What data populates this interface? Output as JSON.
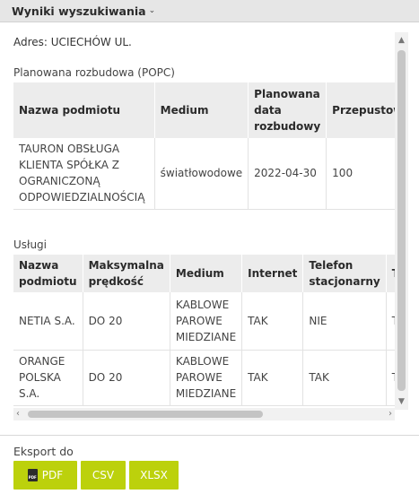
{
  "header": {
    "title": "Wyniki wyszukiwania",
    "chevron_icon": "chevron-down-icon"
  },
  "address": "Adres: UCIECHÓW UL.",
  "planned": {
    "title": "Planowana rozbudowa (POPC)",
    "headers": [
      "Nazwa podmiotu",
      "Medium",
      "Planowana data rozbudowy",
      "Przepustowość"
    ],
    "rows": [
      [
        "TAURON OBSŁUGA KLIENTA SPÓŁKA Z OGRANICZONĄ ODPOWIEDZIALNOŚCIĄ",
        "światłowodowe",
        "2022-04-30",
        "100"
      ]
    ]
  },
  "services": {
    "title": "Usługi",
    "headers": [
      "Nazwa podmiotu",
      "Maksymalna prędkość",
      "Medium",
      "Internet",
      "Telefon stacjonarny",
      "Telewizja"
    ],
    "rows": [
      [
        "NETIA S.A.",
        "DO 20",
        "KABLOWE PAROWE MIEDZIANE",
        "TAK",
        "NIE",
        "TAK"
      ],
      [
        "ORANGE POLSKA S.A.",
        "DO 20",
        "KABLOWE PAROWE MIEDZIANE",
        "TAK",
        "TAK",
        "TAK"
      ]
    ]
  },
  "export": {
    "label": "Eksport do",
    "buttons": {
      "pdf": "PDF",
      "csv": "CSV",
      "xlsx": "XLSX"
    },
    "pdf_icon": "pdf-file-icon"
  },
  "colors": {
    "accent": "#bcd10c",
    "header_bg": "#e6e6e6",
    "table_header_bg": "#ececec"
  }
}
